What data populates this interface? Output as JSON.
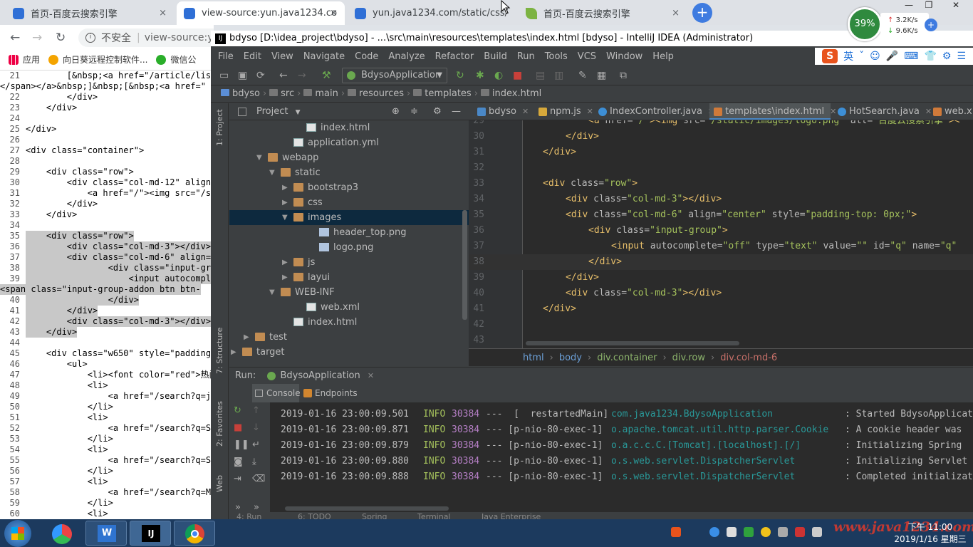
{
  "chrome": {
    "tabs": [
      {
        "title": "首页-百度云搜索引擎",
        "icon": "paw-icon"
      },
      {
        "title": "view-source:yun.java1234.com",
        "icon": "paw-icon",
        "active": true
      },
      {
        "title": "yun.java1234.com/static/css/c",
        "icon": "paw-icon"
      },
      {
        "title": "首页-百度云搜索引擎",
        "icon": "leaf-icon"
      }
    ],
    "close_glyph": "×",
    "new_tab_glyph": "+",
    "omnibox": {
      "insecure": "不安全",
      "url": "view-source:y"
    },
    "bookmarks": [
      "应用",
      "向日葵远程控制软件...",
      "微信公"
    ]
  },
  "net_widget": {
    "percent": "39%",
    "up": "3.2K/s",
    "down": "9.6K/s"
  },
  "view_source": {
    "lines": [
      {
        "n": "21",
        "t": "        [&nbsp;<a href=\"/article/lis"
      },
      {
        "n": "",
        "t": "</span></a>&nbsp;]&nbsp;[&nbsp;<a href=\""
      },
      {
        "n": "22",
        "t": "        </div>"
      },
      {
        "n": "23",
        "t": "    </div>"
      },
      {
        "n": "24",
        "t": ""
      },
      {
        "n": "25",
        "t": "</div>"
      },
      {
        "n": "26",
        "t": ""
      },
      {
        "n": "27",
        "t": "<div class=\"container\">"
      },
      {
        "n": "28",
        "t": ""
      },
      {
        "n": "29",
        "t": "    <div class=\"row\">"
      },
      {
        "n": "30",
        "t": "        <div class=\"col-md-12\" align=\"ce"
      },
      {
        "n": "31",
        "t": "            <a href=\"/\"><img src=\"/stati"
      },
      {
        "n": "32",
        "t": "        </div>"
      },
      {
        "n": "33",
        "t": "    </div>"
      },
      {
        "n": "34",
        "t": ""
      },
      {
        "n": "35",
        "t": "    <div class=\"row\">",
        "sel": true
      },
      {
        "n": "36",
        "t": "        <div class=\"col-md-3\"></div>",
        "sel": true
      },
      {
        "n": "37",
        "t": "        <div class=\"col-md-6\" align=\"cen",
        "sel": true
      },
      {
        "n": "38",
        "t": "                <div class=\"input-group\"",
        "sel": true
      },
      {
        "n": "39",
        "t": "                    <input autocomplete=",
        "sel": true
      },
      {
        "n": "",
        "t": "<span class=\"input-group-addon btn btn-",
        "sel": true
      },
      {
        "n": "40",
        "t": "                </div>",
        "sel": true
      },
      {
        "n": "41",
        "t": "        </div>",
        "sel": true
      },
      {
        "n": "42",
        "t": "        <div class=\"col-md-3\"></div>",
        "sel": true
      },
      {
        "n": "43",
        "t": "    </div>",
        "sel": true
      },
      {
        "n": "44",
        "t": ""
      },
      {
        "n": "45",
        "t": "    <div class=\"w650\" style=\"padding-top"
      },
      {
        "n": "46",
        "t": "        <ul>"
      },
      {
        "n": "47",
        "t": "            <li><font color=\"red\">热门搜"
      },
      {
        "n": "48",
        "t": "            <li>"
      },
      {
        "n": "49",
        "t": "                <a href=\"/search?q=java"
      },
      {
        "n": "50",
        "t": "            </li>"
      },
      {
        "n": "51",
        "t": "            <li>"
      },
      {
        "n": "52",
        "t": "                <a href=\"/search?q=Sprin"
      },
      {
        "n": "53",
        "t": "            </li>"
      },
      {
        "n": "54",
        "t": "            <li>"
      },
      {
        "n": "55",
        "t": "                <a href=\"/search?q=Sprin"
      },
      {
        "n": "56",
        "t": "            </li>"
      },
      {
        "n": "57",
        "t": "            <li>"
      },
      {
        "n": "58",
        "t": "                <a href=\"/search?q=Mybat"
      },
      {
        "n": "59",
        "t": "            </li>"
      },
      {
        "n": "60",
        "t": "            <li>"
      }
    ]
  },
  "idea": {
    "title": "bdyso [D:\\idea_project\\bdyso] - ...\\src\\main\\resources\\templates\\index.html [bdyso] - IntelliJ IDEA (Administrator)",
    "menu": [
      "File",
      "Edit",
      "View",
      "Navigate",
      "Code",
      "Analyze",
      "Refactor",
      "Build",
      "Run",
      "Tools",
      "VCS",
      "Window",
      "Help"
    ],
    "ime": [
      "英",
      "ˇ",
      "☺",
      "🎤",
      "⌨",
      "👕",
      "⚙",
      "☰"
    ],
    "run_config": "BdysoApplication",
    "breadcrumb": [
      "bdyso",
      "src",
      "main",
      "resources",
      "templates",
      "index.html"
    ],
    "project_header": "Project",
    "strip_labels": {
      "project": "1: Project",
      "structure": "7: Structure",
      "favorites": "2: Favorites",
      "web": "Web"
    },
    "tree": [
      {
        "name": "index.html",
        "indent": 6,
        "icon": "html-file-icon"
      },
      {
        "name": "application.yml",
        "indent": 5,
        "icon": "yml-file-icon"
      },
      {
        "name": "webapp",
        "indent": 3,
        "icon": "folder-icon",
        "arrow": "▼"
      },
      {
        "name": "static",
        "indent": 4,
        "icon": "folder-icon",
        "arrow": "▼"
      },
      {
        "name": "bootstrap3",
        "indent": 5,
        "icon": "folder-icon",
        "arrow": "▶"
      },
      {
        "name": "css",
        "indent": 5,
        "icon": "folder-icon",
        "arrow": "▶"
      },
      {
        "name": "images",
        "indent": 5,
        "icon": "folder-icon",
        "arrow": "▼",
        "sel": true
      },
      {
        "name": "header_top.png",
        "indent": 7,
        "icon": "image-file-icon"
      },
      {
        "name": "logo.png",
        "indent": 7,
        "icon": "image-file-icon"
      },
      {
        "name": "js",
        "indent": 5,
        "icon": "folder-icon",
        "arrow": "▶"
      },
      {
        "name": "layui",
        "indent": 5,
        "icon": "folder-icon",
        "arrow": "▶"
      },
      {
        "name": "WEB-INF",
        "indent": 4,
        "icon": "folder-icon",
        "arrow": "▼"
      },
      {
        "name": "web.xml",
        "indent": 6,
        "icon": "xml-file-icon"
      },
      {
        "name": "index.html",
        "indent": 5,
        "icon": "html-file-icon"
      },
      {
        "name": "test",
        "indent": 2,
        "icon": "folder-icon",
        "arrow": "▶"
      },
      {
        "name": "target",
        "indent": 1,
        "icon": "folder-icon",
        "arrow": "▶"
      }
    ],
    "editor_tabs": [
      {
        "label": "bdyso",
        "icon": "m-icon"
      },
      {
        "label": "npm.js",
        "icon": "js-icon"
      },
      {
        "label": "IndexController.java",
        "icon": "class-icon"
      },
      {
        "label": "templates\\index.html",
        "icon": "html-icon",
        "active": true
      },
      {
        "label": "HotSearch.java",
        "icon": "class-icon"
      },
      {
        "label": "web.x",
        "icon": "xml-icon"
      }
    ],
    "editor_lines": [
      {
        "n": "29",
        "indent": 2,
        "parts": [
          [
            "ht",
            "<a "
          ],
          [
            "ha",
            "href="
          ],
          [
            "hv",
            "\"/\""
          ],
          [
            "ht",
            "><img "
          ],
          [
            "ha",
            "src="
          ],
          [
            "hv",
            "\"/static/images/logo.png\""
          ],
          [
            "ha",
            " alt="
          ],
          [
            "hv",
            "\"百度云搜索引擎\""
          ],
          [
            "ht",
            "><"
          ]
        ]
      },
      {
        "n": "30",
        "indent": 1,
        "parts": [
          [
            "ht",
            "</div>"
          ]
        ]
      },
      {
        "n": "31",
        "indent": 0,
        "parts": [
          [
            "ht",
            "</div>"
          ]
        ]
      },
      {
        "n": "32",
        "indent": 0,
        "parts": []
      },
      {
        "n": "33",
        "indent": 0,
        "parts": [
          [
            "ht",
            "<div "
          ],
          [
            "ha",
            "class="
          ],
          [
            "hv",
            "\"row\""
          ],
          [
            "ht",
            ">"
          ]
        ]
      },
      {
        "n": "34",
        "indent": 1,
        "parts": [
          [
            "ht",
            "<div "
          ],
          [
            "ha",
            "class="
          ],
          [
            "hv",
            "\"col-md-3\""
          ],
          [
            "ht",
            "></div>"
          ]
        ]
      },
      {
        "n": "35",
        "indent": 1,
        "parts": [
          [
            "ht",
            "<div "
          ],
          [
            "ha",
            "class="
          ],
          [
            "hv",
            "\"col-md-6\""
          ],
          [
            "ha",
            " align="
          ],
          [
            "hv",
            "\"center\""
          ],
          [
            "ha",
            " style="
          ],
          [
            "hv",
            "\"padding-top: 0px;\""
          ],
          [
            "ht",
            ">"
          ]
        ]
      },
      {
        "n": "36",
        "indent": 2,
        "parts": [
          [
            "ht",
            "<div "
          ],
          [
            "ha",
            "class="
          ],
          [
            "hv",
            "\"input-group\""
          ],
          [
            "ht",
            ">"
          ]
        ]
      },
      {
        "n": "37",
        "indent": 3,
        "parts": [
          [
            "ht",
            "<input "
          ],
          [
            "ha",
            "autocomplete="
          ],
          [
            "hv",
            "\"off\""
          ],
          [
            "ha",
            " type="
          ],
          [
            "hv",
            "\"text\""
          ],
          [
            "ha",
            " value="
          ],
          [
            "hv",
            "\"\""
          ],
          [
            "ha",
            " id="
          ],
          [
            "hv",
            "\"q\""
          ],
          [
            "ha",
            " name="
          ],
          [
            "hv",
            "\"q\""
          ]
        ]
      },
      {
        "n": "38",
        "indent": 2,
        "parts": [
          [
            "ht",
            "</div>"
          ]
        ],
        "cur": true
      },
      {
        "n": "39",
        "indent": 1,
        "parts": [
          [
            "ht",
            "</div>"
          ]
        ]
      },
      {
        "n": "40",
        "indent": 1,
        "parts": [
          [
            "ht",
            "<div "
          ],
          [
            "ha",
            "class="
          ],
          [
            "hv",
            "\"col-md-3\""
          ],
          [
            "ht",
            "></div>"
          ]
        ]
      },
      {
        "n": "41",
        "indent": 0,
        "parts": [
          [
            "ht",
            "</div>"
          ]
        ]
      },
      {
        "n": "42",
        "indent": 0,
        "parts": []
      },
      {
        "n": "43",
        "indent": 0,
        "parts": []
      }
    ],
    "editor_breadcrumb": [
      "html",
      "body",
      "div.container",
      "div.row",
      "div.col-md-6"
    ],
    "run_label": "Run:",
    "run_tab": "BdysoApplication",
    "console_tabs": [
      "Console",
      "Endpoints"
    ],
    "log": [
      {
        "ts": "2019-01-16 23:00:09.501",
        "lvl": "INFO",
        "pid": "30384",
        "thread": "---  [  restartedMain]",
        "logger": "com.java1234.BdysoApplication",
        "msg": ": Started BdysoApplicat"
      },
      {
        "ts": "2019-01-16 23:00:09.871",
        "lvl": "INFO",
        "pid": "30384",
        "thread": "--- [p-nio-80-exec-1]",
        "logger": "o.apache.tomcat.util.http.parser.Cookie",
        "msg": ": A cookie header was"
      },
      {
        "ts": "2019-01-16 23:00:09.879",
        "lvl": "INFO",
        "pid": "30384",
        "thread": "--- [p-nio-80-exec-1]",
        "logger": "o.a.c.c.C.[Tomcat].[localhost].[/]",
        "msg": ": Initializing Spring"
      },
      {
        "ts": "2019-01-16 23:00:09.880",
        "lvl": "INFO",
        "pid": "30384",
        "thread": "--- [p-nio-80-exec-1]",
        "logger": "o.s.web.servlet.DispatcherServlet",
        "msg": ": Initializing Servlet"
      },
      {
        "ts": "2019-01-16 23:00:09.888",
        "lvl": "INFO",
        "pid": "30384",
        "thread": "--- [p-nio-80-exec-1]",
        "logger": "o.s.web.servlet.DispatcherServlet",
        "msg": ": Completed initializat"
      }
    ],
    "bottom_tabs": [
      "4: Run",
      "6: TODO",
      "Spring",
      "Terminal",
      "Java Enterprise"
    ]
  },
  "taskbar": {
    "clock_time": "下午 11:00",
    "clock_date": "2019/1/16 星期三",
    "watermark": "www.java1234.com"
  }
}
